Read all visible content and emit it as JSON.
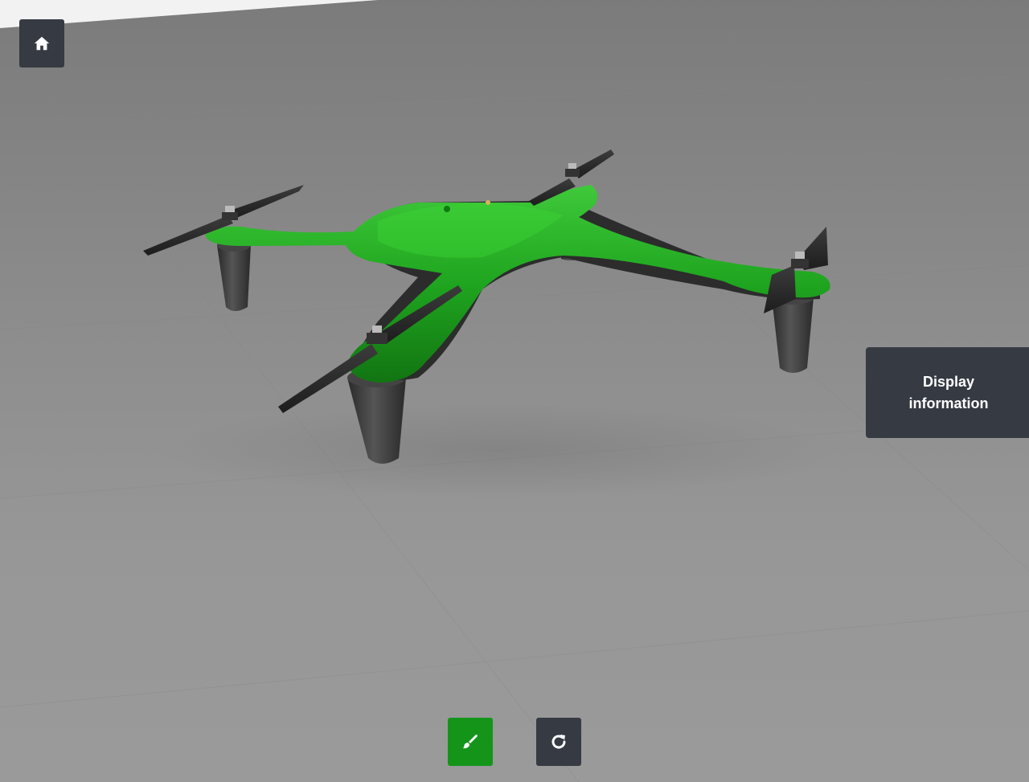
{
  "viewer": {
    "display_info_label": "Display\ninformation",
    "model_color": "#1fa51f",
    "accent_green": "#14951a",
    "panel_dark": "#363a42",
    "floor_color": "#8c8c8c"
  },
  "icons": {
    "home": "home-icon",
    "paint": "paintbrush-icon",
    "reset": "rotate-icon"
  }
}
